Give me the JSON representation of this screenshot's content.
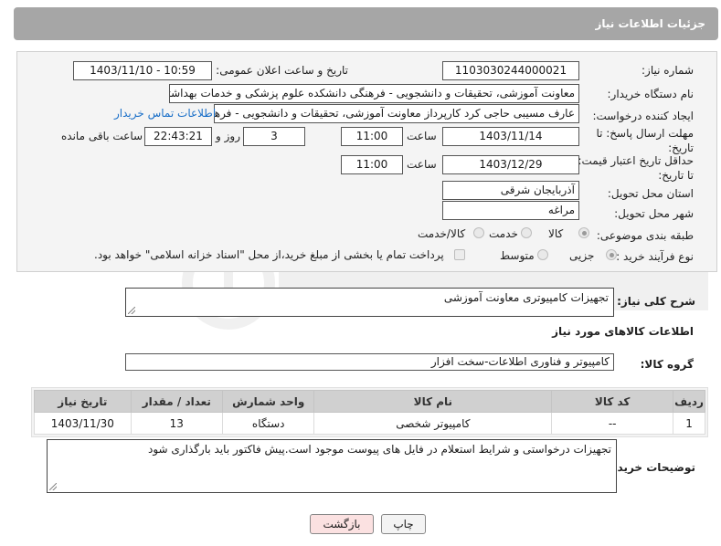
{
  "header": {
    "title": "جزئیات اطلاعات نیاز"
  },
  "form": {
    "need_number_label": "شماره نیاز:",
    "need_number": "1103030244000021",
    "announce_label": "تاریخ و ساعت اعلان عمومی:",
    "announce_value": "1403/11/10 - 10:59",
    "buyer_org_label": "نام دستگاه خریدار:",
    "buyer_org": "معاونت آموزشی، تحقیقات و دانشجویی - فرهنگی دانشکده علوم پزشکی و خدمات بهداشتی",
    "requester_label": "ایجاد کننده درخواست:",
    "requester": "عارف مسیبی حاجی کرد کارپرداز معاونت آموزشی، تحقیقات و دانشجویی - فرهنگی",
    "contact_link": "اطلاعات تماس خریدار",
    "deadline_label": "مهلت ارسال پاسخ: تا تاریخ:",
    "deadline_date": "1403/11/14",
    "time_label": "ساعت",
    "deadline_time": "11:00",
    "days": "3",
    "days_label": "روز و",
    "remaining": "22:43:21",
    "remaining_label": "ساعت باقی مانده",
    "validity_label": "حداقل تاریخ اعتبار قیمت: تا تاریخ:",
    "validity_date": "1403/12/29",
    "validity_time": "11:00",
    "province_label": "استان محل تحویل:",
    "province": "آذربایجان شرقی",
    "city_label": "شهر محل تحویل:",
    "city": "مراغه",
    "category_label": "طبقه بندی موضوعی:",
    "category_options": [
      "کالا",
      "خدمت",
      "کالا/خدمت"
    ],
    "process_label": "نوع فرآیند خرید :",
    "process_options": [
      "جزیی",
      "متوسط"
    ],
    "payment_note": "پرداخت تمام یا بخشی از مبلغ خرید،از محل \"اسناد خزانه اسلامی\" خواهد بود."
  },
  "summary": {
    "label": "شرح کلی نیاز:",
    "text": "تجهیزات کامپیوتری معاونت آموزشی"
  },
  "goods_info_title": "اطلاعات کالاهای مورد نیاز",
  "goods_group": {
    "label": "گروه کالا:",
    "value": "کامپیوتر و فناوری اطلاعات-سخت افزار"
  },
  "table": {
    "headers": [
      "ردیف",
      "کد کالا",
      "نام کالا",
      "واحد شمارش",
      "تعداد / مقدار",
      "تاریخ نیاز"
    ],
    "rows": [
      [
        "1",
        "--",
        "کامپیوتر شخصی",
        "دستگاه",
        "13",
        "1403/11/30"
      ]
    ]
  },
  "buyer_notes": {
    "label": "توضیحات خریدار:",
    "text": "تجهیزات درخواستی و شرایط استعلام در فایل های پیوست موجود است.پیش فاکتور باید بارگذاری شود"
  },
  "buttons": {
    "print": "چاپ",
    "back": "بازگشت"
  },
  "colors": {
    "header_bg": "#a6a6a6",
    "link": "#1a6fc8",
    "back_button_bg": "#fbe1e1"
  }
}
